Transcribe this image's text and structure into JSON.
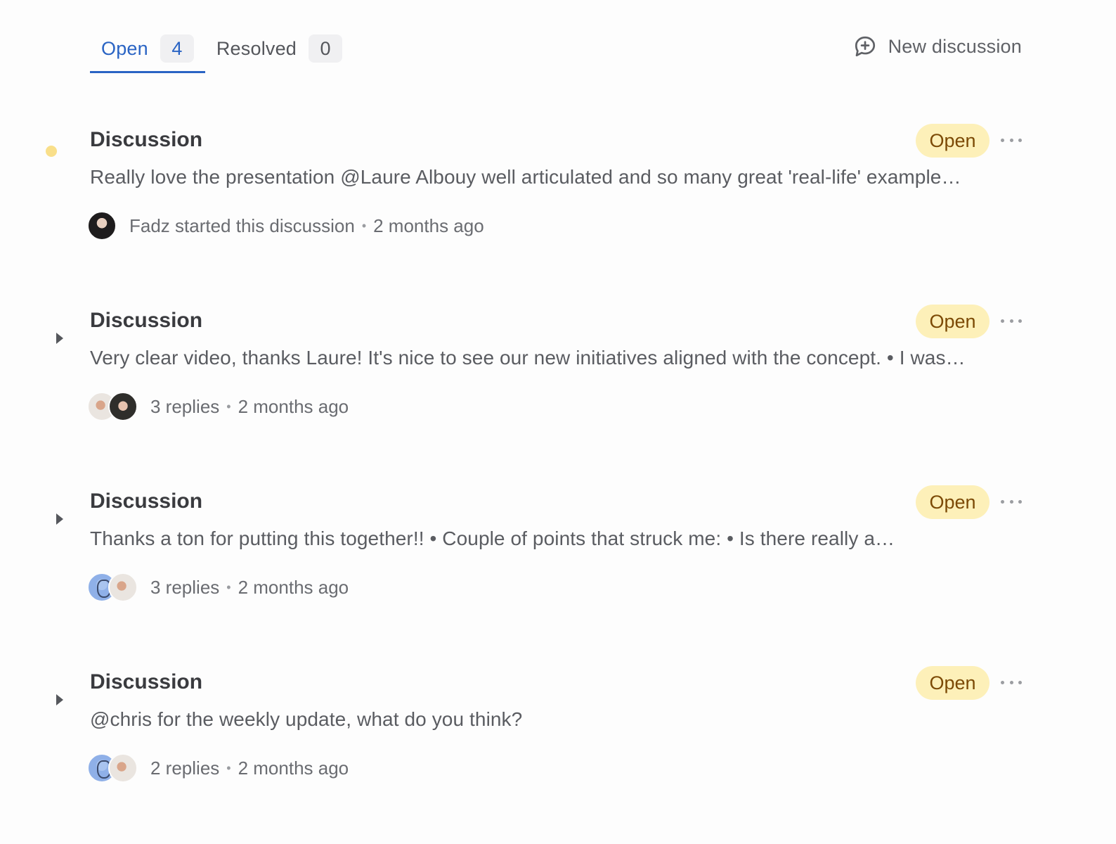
{
  "tabs": [
    {
      "label": "Open",
      "count": "4",
      "active": true
    },
    {
      "label": "Resolved",
      "count": "0",
      "active": false
    }
  ],
  "new_discussion": {
    "label": "New discussion",
    "icon": "chat-plus-icon"
  },
  "colors": {
    "accent": "#2a64c4",
    "badge_bg": "#fdf0b9",
    "badge_text": "#7c4a06",
    "unread_dot": "#f9df8a"
  },
  "discussions": [
    {
      "title": "Discussion",
      "status": "Open",
      "body": "Really love the presentation @Laure Albouy well articulated and so many great 'real-life' example…",
      "meta_text": "Fadz started this discussion",
      "time": "2 months ago",
      "marker": "unread-dot"
    },
    {
      "title": "Discussion",
      "status": "Open",
      "body": "Very clear video, thanks Laure! It's nice to see our new initiatives aligned with the concept. • I was…",
      "meta_text": "3 replies",
      "time": "2 months ago",
      "marker": "expand-caret"
    },
    {
      "title": "Discussion",
      "status": "Open",
      "body": "Thanks a ton for putting this together!! • Couple of points that struck me: • Is there really a…",
      "meta_text": "3 replies",
      "time": "2 months ago",
      "marker": "expand-caret"
    },
    {
      "title": "Discussion",
      "status": "Open",
      "body": "@chris for the weekly update, what do you think?",
      "meta_text": "2 replies",
      "time": "2 months ago",
      "marker": "expand-caret"
    }
  ],
  "separator": "•"
}
